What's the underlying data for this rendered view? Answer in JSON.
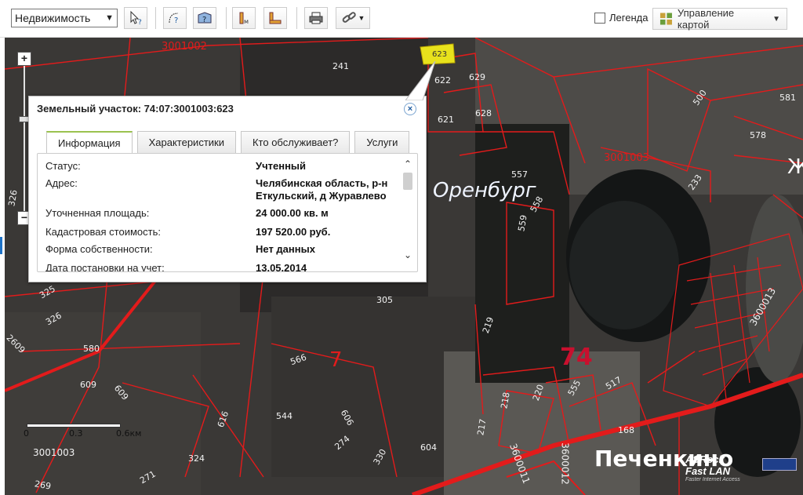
{
  "toolbar": {
    "layer_select_value": "Недвижимость",
    "legend_label": "Легенда",
    "map_control_label": "Управление картой"
  },
  "map": {
    "labels": {
      "block_3001002": "3001002",
      "p241": "241",
      "p623": "623",
      "p622": "622",
      "p629": "629",
      "p621": "621",
      "p628": "628",
      "p500": "500",
      "p581": "581",
      "p578": "578",
      "block_3001003_east": "3001003",
      "p233": "233",
      "p557": "557",
      "p558": "558",
      "p559": "559",
      "town_orenburg": "Оренбург",
      "p325": "325",
      "p326": "326",
      "p305": "305",
      "p219": "219",
      "p2609": "2609",
      "p580": "580",
      "p566": "566",
      "region_7": "7",
      "region_74": "74",
      "p609a": "609",
      "p609b": "609",
      "p616": "616",
      "p544": "544",
      "p606": "606",
      "p274": "274",
      "p218": "218",
      "p220": "220",
      "p555": "555",
      "p517": "517",
      "p168": "168",
      "block_3600013": "3600013",
      "block_3001003_sw": "3001003",
      "p324": "324",
      "p604": "604",
      "p217": "217",
      "p330": "330",
      "p269": "269",
      "p271": "271",
      "block_3600011": "3600011",
      "block_3600012": "3600012",
      "town_pechenkino": "Печенкино",
      "p326left": "326",
      "letter_zh": "Ж"
    },
    "scale": {
      "t0": "0",
      "t1": "0.3",
      "t2": "0.6км"
    },
    "asrock_line1": "ASRock",
    "asrock_line2": "Fast LAN",
    "asrock_line3": "Faster Internet Access"
  },
  "popup": {
    "title": "Земельный участок: 74:07:3001003:623",
    "tabs": [
      "Информация",
      "Характеристики",
      "Кто обслуживает?",
      "Услуги"
    ],
    "rows": [
      {
        "k": "Статус:",
        "v": "Учтенный"
      },
      {
        "k": "Адрес:",
        "v": "Челябинская область, р-н Еткульский, д Журавлево"
      },
      {
        "k": "Уточненная площадь:",
        "v": "24 000.00 кв. м"
      },
      {
        "k": "Кадастровая стоимость:",
        "v": "197 520.00 руб."
      },
      {
        "k": "Форма собственности:",
        "v": "Нет данных"
      },
      {
        "k": "Дата постановки на учет:",
        "v": "13.05.2014"
      }
    ]
  },
  "colors": {
    "boundary": "#e31b1b",
    "highlight": "#e8e21c",
    "tab_accent": "#9bc24f"
  }
}
